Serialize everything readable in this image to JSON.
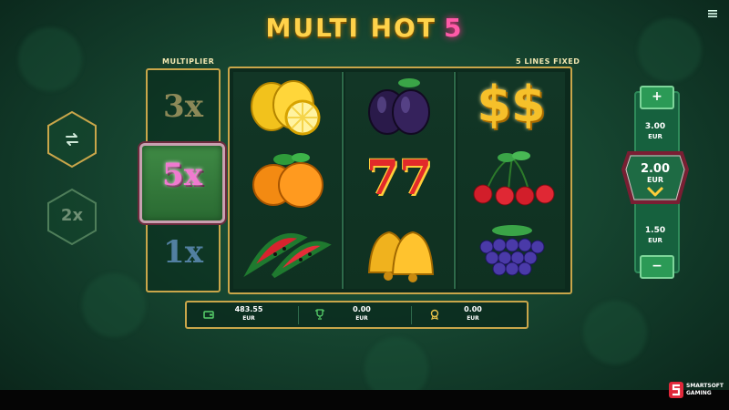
{
  "game": {
    "title_main": "MULTI HOT",
    "title_num": "5"
  },
  "labels": {
    "multiplier": "MULTIPLIER",
    "lines": "5 LINES FIXED"
  },
  "multipliers": {
    "top": "3x",
    "active": "5x",
    "bottom": "1x",
    "side_button": "2x"
  },
  "symbols": [
    {
      "reel": 1,
      "row": 1,
      "name": "lemons"
    },
    {
      "reel": 1,
      "row": 2,
      "name": "oranges"
    },
    {
      "reel": 1,
      "row": 3,
      "name": "watermelon"
    },
    {
      "reel": 2,
      "row": 1,
      "name": "plums"
    },
    {
      "reel": 2,
      "row": 2,
      "name": "sevens"
    },
    {
      "reel": 2,
      "row": 3,
      "name": "bells"
    },
    {
      "reel": 3,
      "row": 1,
      "name": "dollars"
    },
    {
      "reel": 3,
      "row": 2,
      "name": "cherries"
    },
    {
      "reel": 3,
      "row": 3,
      "name": "grapes"
    }
  ],
  "symbol_text": {
    "sevens": "77",
    "dollars": "$$"
  },
  "bet": {
    "plus": "+",
    "minus": "−",
    "upper_value": "3.00",
    "upper_currency": "EUR",
    "current_value": "2.00",
    "current_currency": "EUR",
    "lower_value": "1.50",
    "lower_currency": "EUR"
  },
  "stats": {
    "balance_value": "483.55",
    "balance_currency": "EUR",
    "win_value": "0.00",
    "win_currency": "EUR",
    "bonus_value": "0.00",
    "bonus_currency": "EUR"
  },
  "brand": {
    "line1": "SMARTSOFT",
    "line2": "GAMING"
  },
  "icons": [
    "menu-icon",
    "autoplay-icon",
    "wallet-icon",
    "trophy-icon",
    "medal-icon",
    "chevron-down-icon",
    "smartsoft-logo-icon"
  ],
  "colors": {
    "gold": "#c9a64a",
    "title": "#ffd24a",
    "accent_pink": "#ff5aa8",
    "bet_green": "#16613e"
  }
}
